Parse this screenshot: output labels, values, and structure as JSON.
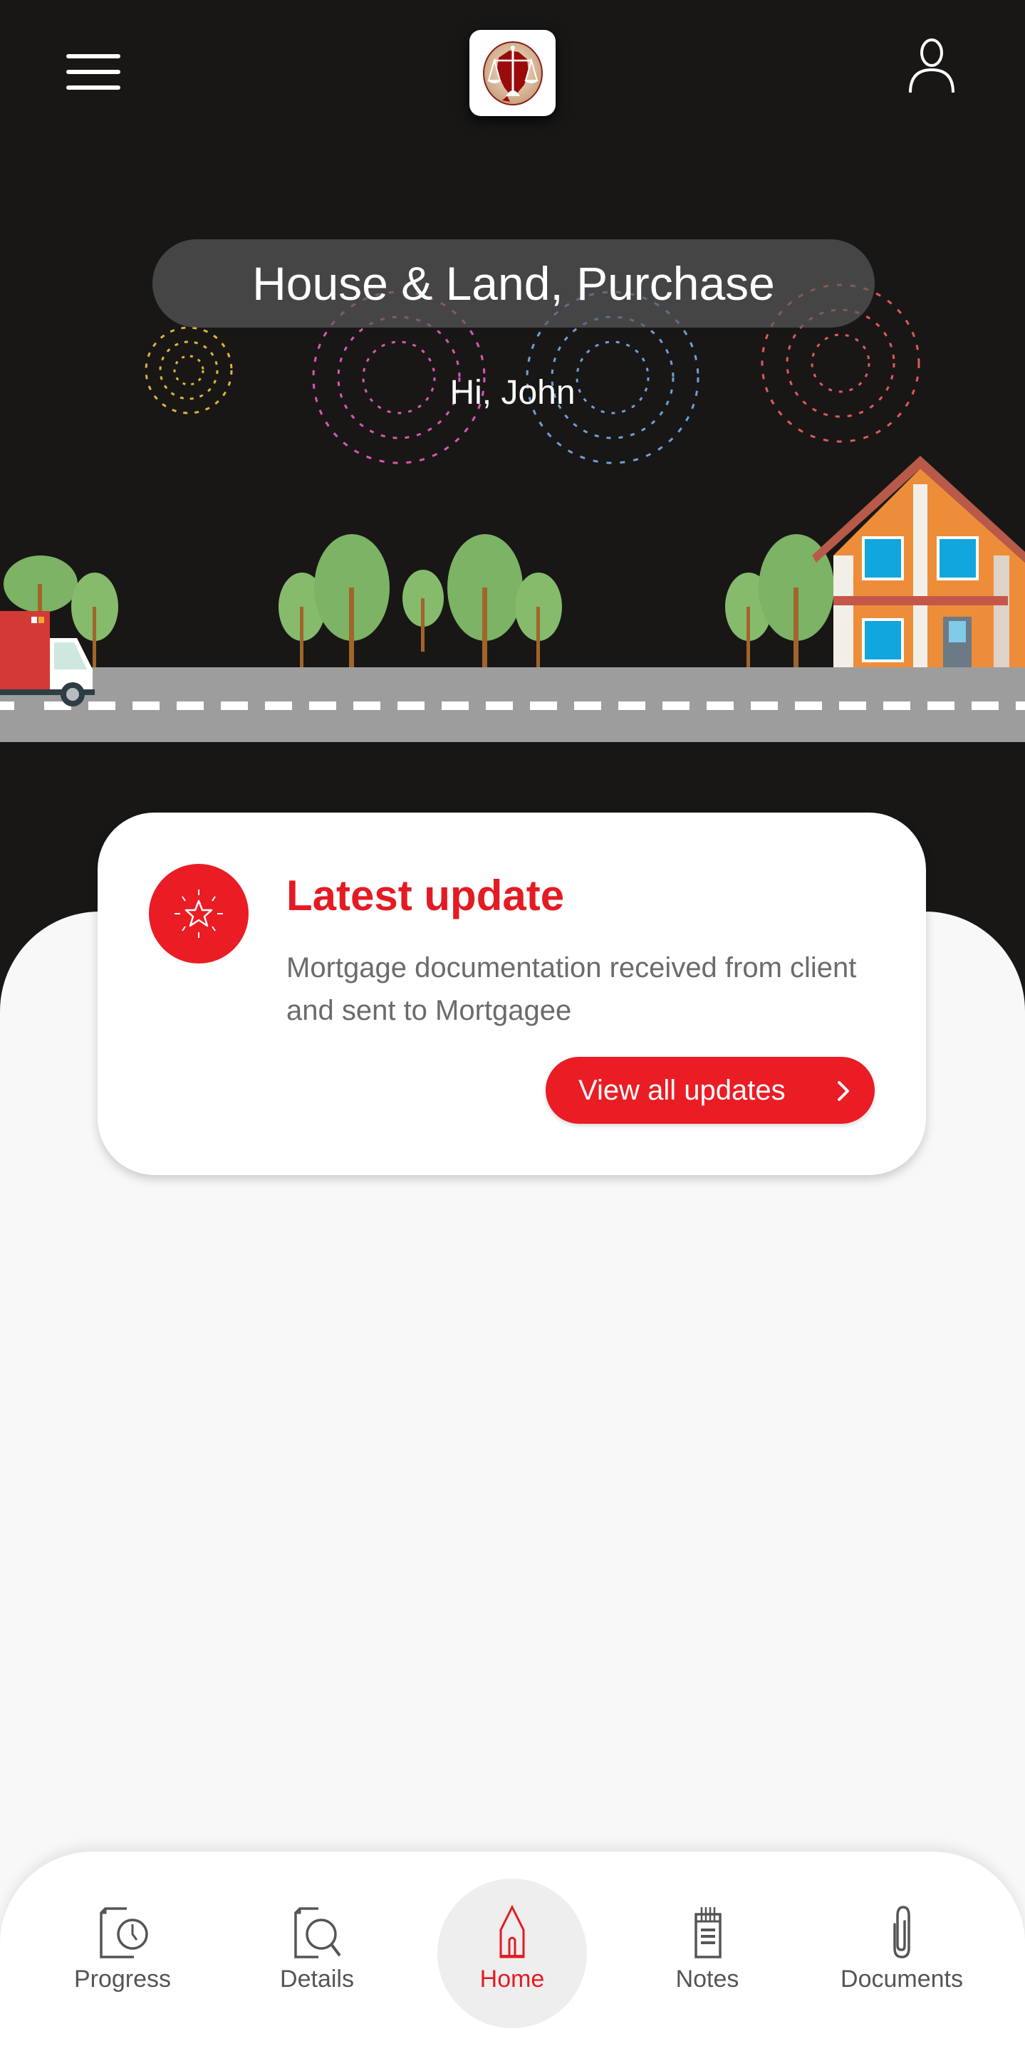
{
  "header": {
    "menu_icon": "hamburger-menu-icon",
    "logo": "scales-of-justice-logo",
    "profile_icon": "user-profile-icon"
  },
  "hero": {
    "matter_title": "House & Land, Purchase",
    "greeting": "Hi, John",
    "illustration": "fireworks, trees, moving truck, house, road"
  },
  "latest_update": {
    "icon": "star-icon",
    "title": "Latest update",
    "description": "Mortgage documentation received from client and sent to Mortgagee",
    "button_label": "View all updates",
    "button_icon": "chevron-right-icon"
  },
  "bottom_nav": {
    "items": [
      {
        "label": "Progress",
        "icon": "document-clock-icon",
        "active": false
      },
      {
        "label": "Details",
        "icon": "document-search-icon",
        "active": false
      },
      {
        "label": "Home",
        "icon": "home-icon",
        "active": true
      },
      {
        "label": "Notes",
        "icon": "notepad-icon",
        "active": false
      },
      {
        "label": "Documents",
        "icon": "paperclip-icon",
        "active": false
      }
    ]
  },
  "colors": {
    "accent": "#e31b23",
    "header_bg": "#181716",
    "page_bg": "#f8f8f8",
    "text_gray": "#6b6b6b"
  }
}
